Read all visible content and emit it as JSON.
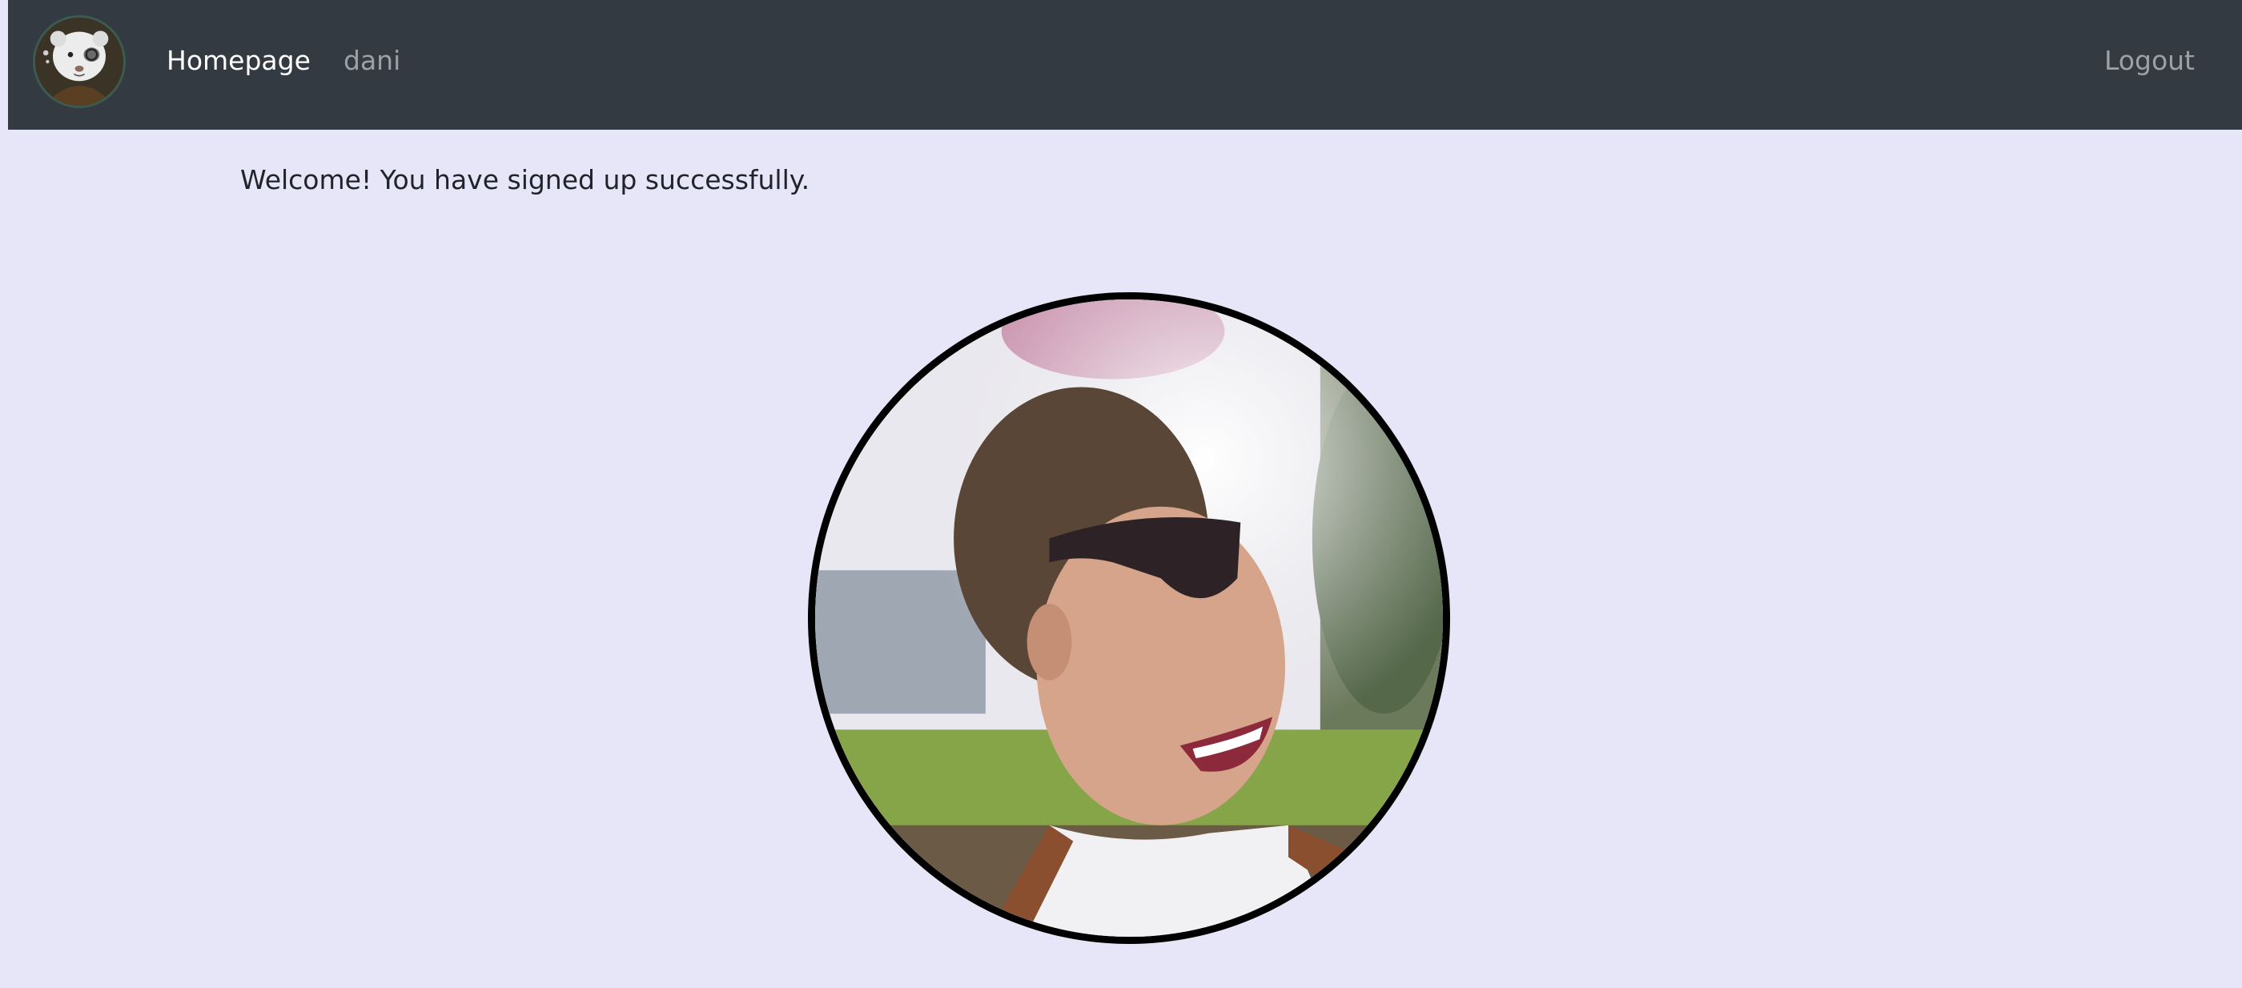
{
  "navbar": {
    "logo_icon": "ferret-mascot-icon",
    "home_label": "Homepage",
    "user_label": "dani",
    "logout_label": "Logout",
    "background_color": "#343a42"
  },
  "main": {
    "welcome_message": "Welcome! You have signed up successfully.",
    "background_color": "#e6e6f8"
  },
  "profile": {
    "image_icon": "profile-photo"
  }
}
